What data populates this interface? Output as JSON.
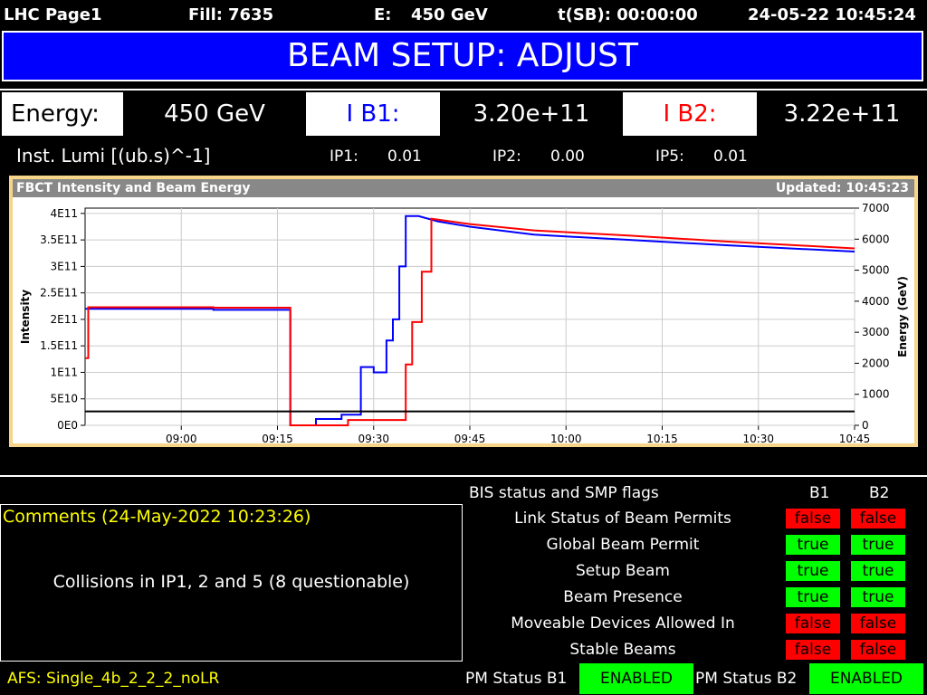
{
  "header": {
    "page": "LHC Page1",
    "fill_label": "Fill:",
    "fill_value": "7635",
    "energy_label": "E:",
    "energy_value": "450 GeV",
    "tsb": "t(SB): 00:00:00",
    "datetime": "24-05-22 10:45:24"
  },
  "banner": {
    "title": "BEAM SETUP: ADJUST"
  },
  "values": {
    "energy_label": "Energy:",
    "energy_value": "450 GeV",
    "ib1_label": "I B1:",
    "ib1_value": "3.20e+11",
    "ib2_label": "I B2:",
    "ib2_value": "3.22e+11"
  },
  "lumi": {
    "label": "Inst. Lumi [(ub.s)^-1]",
    "ip1_label": "IP1:",
    "ip1_value": "0.01",
    "ip2_label": "IP2:",
    "ip2_value": "0.00",
    "ip5_label": "IP5:",
    "ip5_value": "0.01"
  },
  "colors": {
    "b1": "#0000ff",
    "b2": "#ff0000",
    "banner": "#0000ff",
    "frame": "#f6d48a",
    "ok": "#00ff00",
    "bad": "#ff0000",
    "comment": "#ffff00"
  },
  "chart_data": {
    "type": "line",
    "title": "FBCT Intensity and Beam Energy",
    "updated": "Updated: 10:45:23",
    "ylabel": "Intensity",
    "y2label": "Energy (GeV)",
    "x_ticks": [
      "09:00",
      "09:15",
      "09:30",
      "09:45",
      "10:00",
      "10:15",
      "10:30",
      "10:45"
    ],
    "y_ticks": [
      "0E0",
      "5E10",
      "1E11",
      "1.5E11",
      "2E11",
      "2.5E11",
      "3E11",
      "3.5E11",
      "4E11"
    ],
    "y2_ticks": [
      "0",
      "1000",
      "2000",
      "3000",
      "4000",
      "5000",
      "6000",
      "7000"
    ],
    "xlim_minutes": [
      525,
      645
    ],
    "ylim": [
      0,
      410000000000.0
    ],
    "y2lim": [
      0,
      7000
    ],
    "grid": true,
    "series": [
      {
        "axis": "left",
        "color": "#0000ff",
        "points": [
          [
            525,
            220000000000.0
          ],
          [
            545,
            220000000000.0
          ],
          [
            545,
            218000000000.0
          ],
          [
            557,
            218000000000.0
          ],
          [
            557,
            0
          ],
          [
            561,
            0
          ],
          [
            561,
            12000000000.0
          ],
          [
            565,
            12000000000.0
          ],
          [
            565,
            20000000000.0
          ],
          [
            568,
            20000000000.0
          ],
          [
            568,
            110000000000.0
          ],
          [
            570,
            110000000000.0
          ],
          [
            570,
            100000000000.0
          ],
          [
            572,
            100000000000.0
          ],
          [
            572,
            160000000000.0
          ],
          [
            573,
            160000000000.0
          ],
          [
            573,
            200000000000.0
          ],
          [
            574,
            200000000000.0
          ],
          [
            574,
            300000000000.0
          ],
          [
            575,
            300000000000.0
          ],
          [
            575,
            395000000000.0
          ],
          [
            577,
            395000000000.0
          ],
          [
            580,
            385000000000.0
          ],
          [
            585,
            375000000000.0
          ],
          [
            595,
            360000000000.0
          ],
          [
            610,
            350000000000.0
          ],
          [
            625,
            340000000000.0
          ],
          [
            645,
            328000000000.0
          ]
        ]
      },
      {
        "axis": "left",
        "color": "#ff0000",
        "points": [
          [
            525,
            127000000000.0
          ],
          [
            525.5,
            127000000000.0
          ],
          [
            525.5,
            223000000000.0
          ],
          [
            545,
            223000000000.0
          ],
          [
            545,
            222000000000.0
          ],
          [
            557,
            222000000000.0
          ],
          [
            557,
            0
          ],
          [
            566,
            0
          ],
          [
            566,
            10000000000.0
          ],
          [
            575,
            10000000000.0
          ],
          [
            575,
            115000000000.0
          ],
          [
            576,
            115000000000.0
          ],
          [
            576,
            195000000000.0
          ],
          [
            577.5,
            195000000000.0
          ],
          [
            577.5,
            290000000000.0
          ],
          [
            579,
            290000000000.0
          ],
          [
            579,
            390000000000.0
          ],
          [
            585,
            380000000000.0
          ],
          [
            595,
            368000000000.0
          ],
          [
            610,
            358000000000.0
          ],
          [
            625,
            347000000000.0
          ],
          [
            645,
            334000000000.0
          ]
        ]
      },
      {
        "axis": "right",
        "color": "#000000",
        "points": [
          [
            525,
            450
          ],
          [
            645,
            450
          ]
        ]
      }
    ]
  },
  "bis": {
    "title": "BIS status and SMP flags",
    "b1": "B1",
    "b2": "B2",
    "rows": [
      {
        "label": "Link Status of Beam Permits",
        "b1": "false",
        "b2": "false"
      },
      {
        "label": "Global Beam Permit",
        "b1": "true",
        "b2": "true"
      },
      {
        "label": "Setup Beam",
        "b1": "true",
        "b2": "true"
      },
      {
        "label": "Beam Presence",
        "b1": "true",
        "b2": "true"
      },
      {
        "label": "Moveable Devices Allowed In",
        "b1": "false",
        "b2": "false"
      },
      {
        "label": "Stable Beams",
        "b1": "false",
        "b2": "false"
      }
    ]
  },
  "comments": {
    "title": "Comments (24-May-2022 10:23:26)",
    "text": "Collisions in IP1, 2 and 5 (8 questionable)"
  },
  "footer": {
    "afs": "AFS: Single_4b_2_2_2_noLR",
    "pm_b1_label": "PM Status B1",
    "pm_b1_value": "ENABLED",
    "pm_b2_label": "PM Status B2",
    "pm_b2_value": "ENABLED"
  }
}
